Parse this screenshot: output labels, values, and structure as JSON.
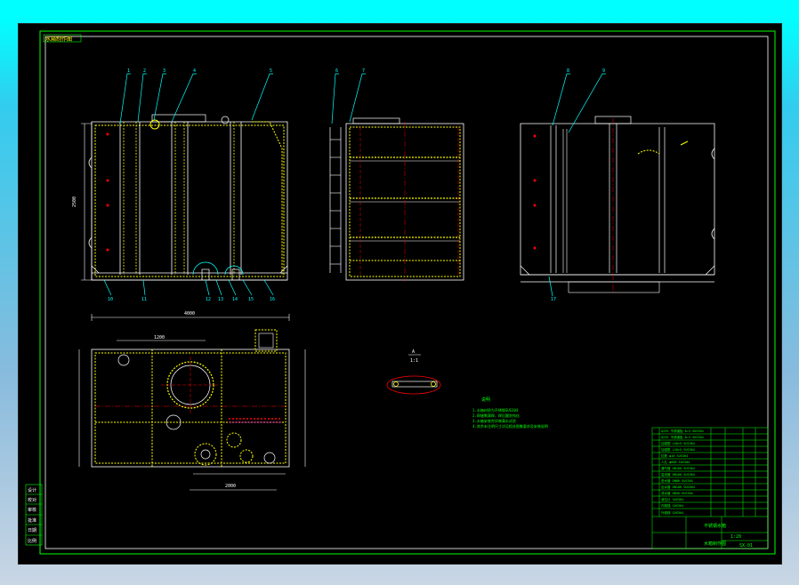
{
  "drawing": {
    "title_tag": "水箱制作图",
    "view_labels": {
      "front_callouts": [
        "1",
        "2",
        "3",
        "4",
        "5"
      ],
      "side_callouts": [
        "6",
        "7"
      ],
      "right_callouts": [
        "8",
        "9"
      ],
      "bottom_callouts_front": [
        "10",
        "11",
        "12",
        "13",
        "14",
        "15",
        "16"
      ],
      "right_bottom_callout": "17"
    },
    "dimension_left": "2500",
    "dimension_top_plan": "4000",
    "dimension_plan_mid": "1200",
    "dimension_plan_bottom": "2000",
    "section_mark_a": "A",
    "section_mark_b": "1:1",
    "notes_title": "说明",
    "notes": [
      "1.水箱材质为不锈钢SUS304",
      "2.焊缝需满焊，焊后酸洗钝化",
      "3.水箱安装完毕做满水试验",
      "4.其余未注明尺寸详见相关图集要求及安装说明"
    ],
    "revision_labels": [
      "设计",
      "校对",
      "审核",
      "批准",
      "日期",
      "比例"
    ],
    "title_block": {
      "project": "不锈钢水箱",
      "drawing_name": "水箱制作图",
      "scale": "1:20",
      "drawing_no": "SX-01"
    }
  },
  "colors": {
    "background": "#000000",
    "frame": "#00ff00",
    "outline": "#ffffff",
    "hidden": "#ffff00",
    "center": "#ff0000",
    "leader": "#00ffff",
    "dimension": "#ffffff",
    "accent": "#ff00ff"
  }
}
